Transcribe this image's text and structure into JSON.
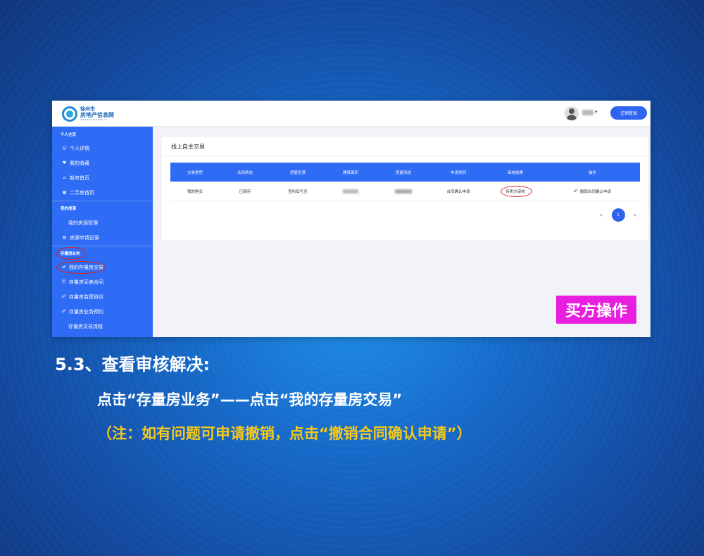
{
  "header": {
    "logo_line1": "徐州市",
    "logo_line2": "房地产信息网",
    "logo_line3": "www.xzhouse.com.cn",
    "user_caret": "▾",
    "logout_label": "注销登录"
  },
  "sidebar": {
    "group_personal": "个人主页",
    "item_personal_details": "个人详情",
    "item_favorites": "我的收藏",
    "item_new_home": "新房首页",
    "item_second_home": "二手房首页",
    "group_listings": "我的房源",
    "item_listing_manage": "我的房源管理",
    "item_listing_apply": "房源申请记录",
    "group_stock": "存量房业务",
    "item_my_stock_trade": "我的存量房交易",
    "item_stock_contract": "存量房买卖合同",
    "item_stock_supervision": "存量房监管协议",
    "item_stock_booking": "存量房业务预约",
    "item_stock_flow": "存量房交易流程"
  },
  "panel": {
    "title": "线上自主交易",
    "columns": [
      "交易类型",
      "合同状态",
      "房屋坐落",
      "建筑面积",
      "房屋用途",
      "申请类别",
      "审核结果",
      "操作"
    ],
    "row": {
      "trade_type": "我的购买",
      "contract_status": "已保存",
      "location": "签约后可见",
      "area": "",
      "usage": "",
      "apply_type": "合同确认申请",
      "audit_result": "待卖方审核",
      "action": "撤销合同确认申请"
    },
    "pager": {
      "prev": "‹",
      "current": "1",
      "next": "›"
    }
  },
  "badge": "买方操作",
  "instructions": {
    "heading": "5.3、查看审核解决:",
    "line1": "点击“存量房业务”——点击“我的存量房交易”",
    "line2": "（注：如有问题可申请撤销，点击“撤销合同确认申请”）"
  },
  "colors": {
    "primary": "#2f6cf5",
    "badge": "#e81ee0",
    "note": "#f6c81b",
    "highlight": "#e02020"
  }
}
